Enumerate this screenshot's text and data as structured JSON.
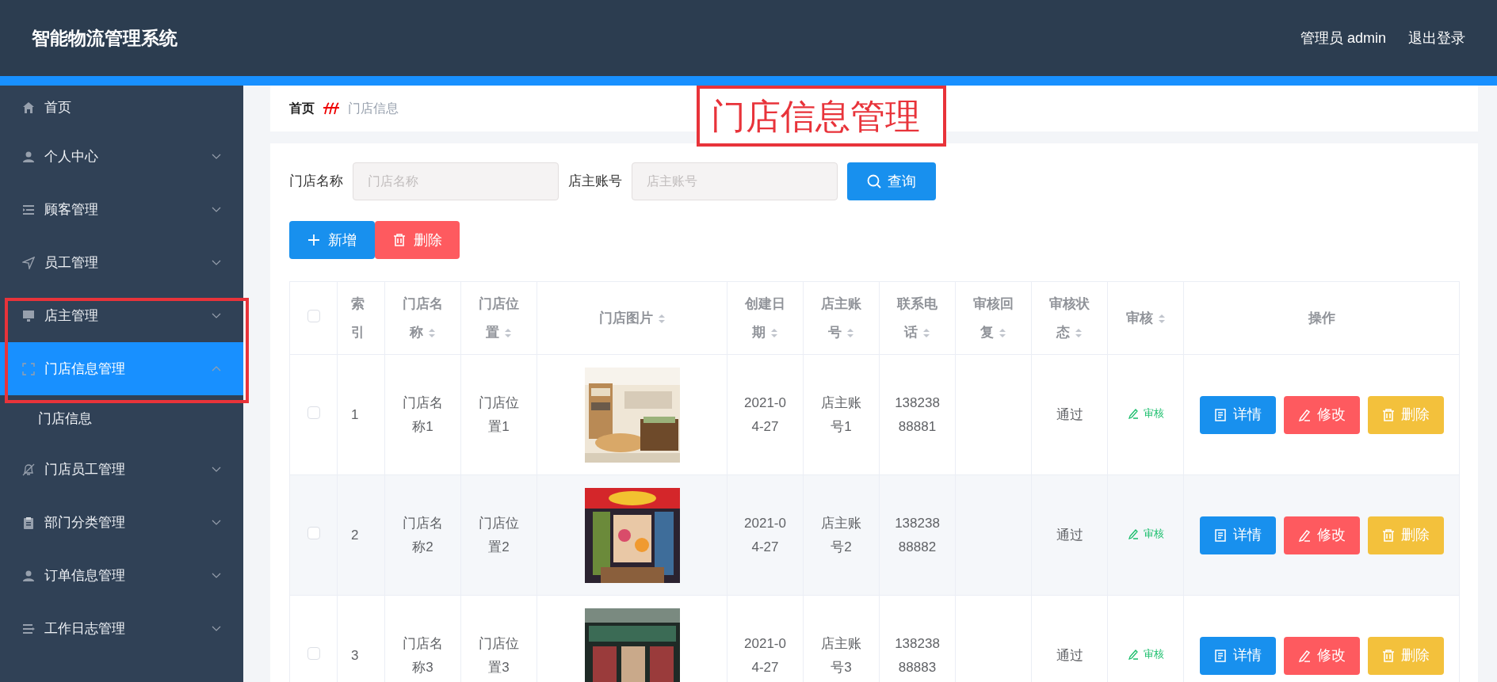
{
  "header": {
    "title": "智能物流管理系统",
    "user": "管理员 admin",
    "logout": "退出登录"
  },
  "sidebar": {
    "items": [
      {
        "label": "首页",
        "kind": "link",
        "selected": false
      },
      {
        "label": "个人中心",
        "kind": "submenu",
        "expanded": false,
        "selected": false
      },
      {
        "label": "顾客管理",
        "kind": "submenu",
        "expanded": false,
        "selected": false
      },
      {
        "label": "员工管理",
        "kind": "submenu",
        "expanded": false,
        "selected": false
      },
      {
        "label": "店主管理",
        "kind": "submenu",
        "expanded": false,
        "selected": false
      },
      {
        "label": "门店信息管理",
        "kind": "submenu",
        "expanded": true,
        "selected": true,
        "children": [
          {
            "label": "门店信息",
            "selected": false
          }
        ]
      },
      {
        "label": "门店员工管理",
        "kind": "submenu",
        "expanded": false,
        "selected": false
      },
      {
        "label": "部门分类管理",
        "kind": "submenu",
        "expanded": false,
        "selected": false
      },
      {
        "label": "订单信息管理",
        "kind": "submenu",
        "expanded": false,
        "selected": false
      },
      {
        "label": "工作日志管理",
        "kind": "submenu",
        "expanded": false,
        "selected": false
      }
    ]
  },
  "breadcrumb": [
    "首页",
    "门店信息"
  ],
  "annotation": {
    "text": "门店信息管理"
  },
  "search": {
    "fields": [
      {
        "label": "门店名称",
        "placeholder": "门店名称"
      },
      {
        "label": "店主账号",
        "placeholder": "店主账号"
      }
    ],
    "button": "查询"
  },
  "toolbar": [
    {
      "label": "新增",
      "kind": "add"
    },
    {
      "label": "删除",
      "kind": "delete"
    }
  ],
  "table": {
    "columns": [
      {
        "kind": "check",
        "checked": false
      },
      {
        "label": "索引",
        "sortable": false
      },
      {
        "label": "门店名称",
        "sortable": true
      },
      {
        "label": "门店位置",
        "sortable": true
      },
      {
        "label": "门店图片",
        "sortable": true
      },
      {
        "label": "创建日期",
        "sortable": true
      },
      {
        "label": "店主账号",
        "sortable": true
      },
      {
        "label": "联系电话",
        "sortable": true
      },
      {
        "label": "审核回复",
        "sortable": true
      },
      {
        "label": "审核状态",
        "sortable": true
      },
      {
        "label": "审核",
        "sortable": true
      },
      {
        "label": "操作",
        "sortable": false
      }
    ],
    "rows": [
      {
        "checked": false,
        "index": "1",
        "name": "门店名称1",
        "location": "门店位置1",
        "date": "2021-04-27",
        "owner": "店主账号1",
        "phone": "13823888881",
        "status": "通过",
        "audit": "审核",
        "actions": [
          {
            "label": "详情",
            "kind": "detail"
          },
          {
            "label": "修改",
            "kind": "edit"
          },
          {
            "label": "删除",
            "kind": "delete"
          }
        ]
      },
      {
        "checked": false,
        "index": "2",
        "name": "门店名称2",
        "location": "门店位置2",
        "date": "2021-04-27",
        "owner": "店主账号2",
        "phone": "13823888882",
        "status": "通过",
        "audit": "审核",
        "actions": [
          {
            "label": "详情",
            "kind": "detail"
          },
          {
            "label": "修改",
            "kind": "edit"
          },
          {
            "label": "删除",
            "kind": "delete"
          }
        ]
      },
      {
        "checked": false,
        "index": "3",
        "name": "门店名称3",
        "location": "门店位置3",
        "date": "2021-04-27",
        "owner": "店主账号3",
        "phone": "13823888883",
        "status": "通过",
        "audit": "审核",
        "actions": [
          {
            "label": "详情",
            "kind": "detail"
          },
          {
            "label": "修改",
            "kind": "edit"
          },
          {
            "label": "删除",
            "kind": "delete"
          }
        ]
      }
    ]
  }
}
